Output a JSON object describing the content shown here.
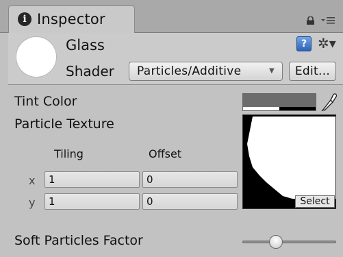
{
  "window": {
    "tab_title": "Inspector",
    "tab_icon": "info-icon",
    "tab_icon_glyph": "i",
    "right_icons": [
      "lock-icon",
      "tab-menu-icon"
    ]
  },
  "material": {
    "name": "Glass",
    "preview": "white-sphere",
    "help_icon_glyph": "?",
    "gear_icon_glyph": "✲▾",
    "shader_label": "Shader",
    "shader_value": "Particles/Additive",
    "dropdown_arrow": "▼",
    "edit_button": "Edit..."
  },
  "properties": {
    "tint_color": {
      "label": "Tint Color",
      "color": "#6c6c6c",
      "alpha": 0.5
    },
    "particle_texture": {
      "label": "Particle Texture",
      "tiling_label": "Tiling",
      "offset_label": "Offset",
      "x_label": "x",
      "y_label": "y",
      "tiling_x": "1",
      "tiling_y": "1",
      "offset_x": "0",
      "offset_y": "0",
      "select_label": "Select"
    },
    "soft_particles_factor": {
      "label": "Soft Particles Factor",
      "slider_value": 0.36
    }
  },
  "colors": {
    "panel_bg": "#c2c2c2",
    "tab_bg": "#c9c9c9",
    "help_blue": "#3f78cc"
  }
}
